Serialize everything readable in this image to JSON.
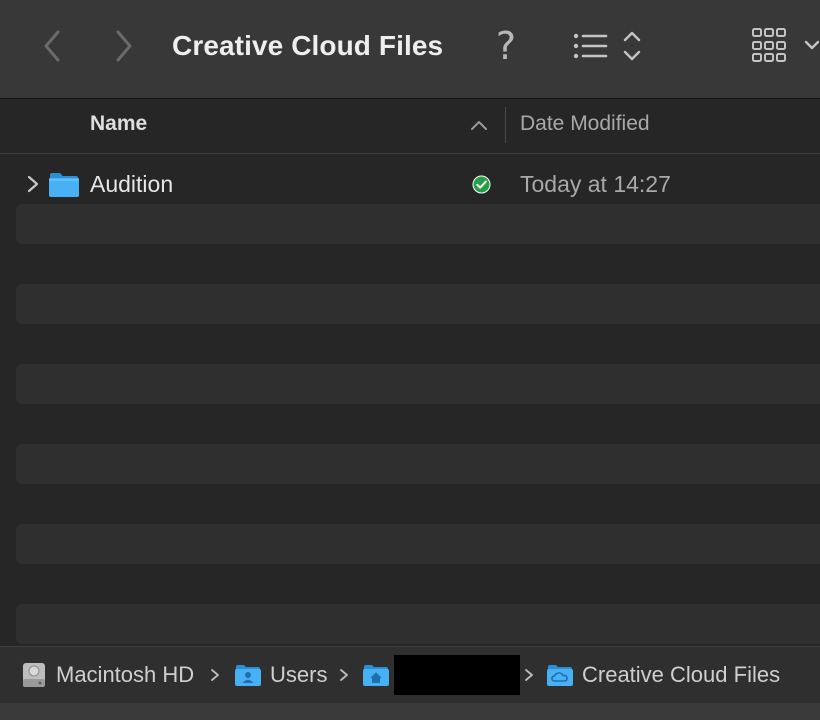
{
  "window": {
    "title": "Creative Cloud Files"
  },
  "toolbar": {
    "back_icon": "chevron-left-icon",
    "forward_icon": "chevron-right-icon",
    "help_label": "?",
    "view_list_icon": "list-view-icon",
    "view_grid_icon": "icon-grid-view-icon"
  },
  "columns": {
    "name": "Name",
    "date_modified": "Date Modified",
    "sort_direction": "ascending"
  },
  "items": [
    {
      "name": "Audition",
      "type": "folder",
      "sync_status": "synced",
      "date_modified": "Today at 14:27"
    }
  ],
  "pathbar": {
    "crumbs": [
      {
        "label": "Macintosh HD",
        "icon": "hard-drive-icon"
      },
      {
        "label": "Users",
        "icon": "users-folder-icon"
      },
      {
        "label": "",
        "icon": "home-folder-icon",
        "redacted": true
      },
      {
        "label": "Creative Cloud Files",
        "icon": "creative-cloud-folder-icon"
      }
    ]
  },
  "colors": {
    "toolbar_bg": "#383838",
    "list_bg": "#262626",
    "alt_row_bg": "#2f2f2f",
    "folder_blue": "#3fa9f5",
    "sync_green": "#28a745"
  }
}
